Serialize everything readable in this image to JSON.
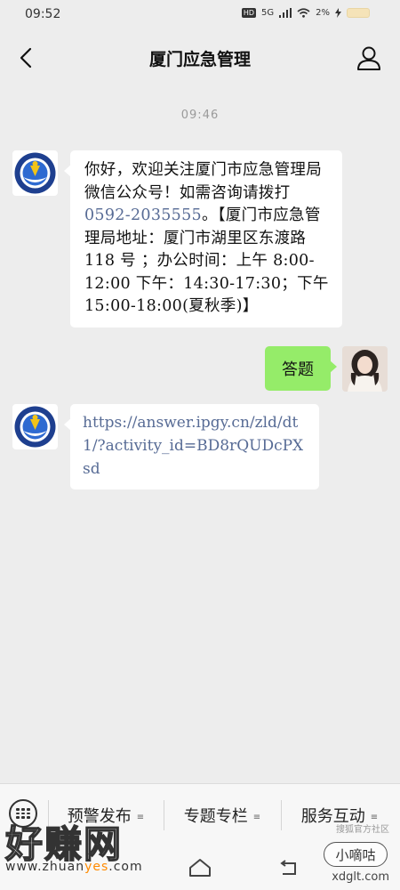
{
  "status": {
    "time": "09:52",
    "network": "5G",
    "battery_pct": "2%"
  },
  "header": {
    "title": "厦门应急管理",
    "back_icon": "chevron-left-icon",
    "profile_icon": "person-icon"
  },
  "chat": {
    "timestamp": "09:46",
    "messages": [
      {
        "side": "left",
        "text_before": "你好，欢迎关注厦门市应急管理局微信公众号！如需咨询请拨打 ",
        "phone": "0592-2035555",
        "text_after": "。【厦门市应急管理局地址：厦门市湖里区东渡路 118 号 ；办公时间：上午 8:00-12:00 下午：14:30-17:30；下午 15:00-18:00(夏秋季)】"
      },
      {
        "side": "right",
        "text": "答题"
      },
      {
        "side": "left",
        "link": "https://answer.ipgy.cn/zld/dt1/?activity_id=BD8rQUDcPXsd"
      }
    ]
  },
  "menu": {
    "items": [
      {
        "label": "预警发布"
      },
      {
        "label": "专题专栏"
      },
      {
        "label": "服务互动"
      }
    ]
  },
  "watermarks": {
    "brand": "好赚网",
    "url_prefix": "www.zhuan",
    "url_accent": "yes",
    "url_suffix": ".com",
    "small": "搜狐官方社区",
    "badge": "小嘀咕",
    "site": "xdglt.com"
  },
  "colors": {
    "background": "#ededed",
    "bubble_self": "#95ec69",
    "link": "#576b95"
  }
}
